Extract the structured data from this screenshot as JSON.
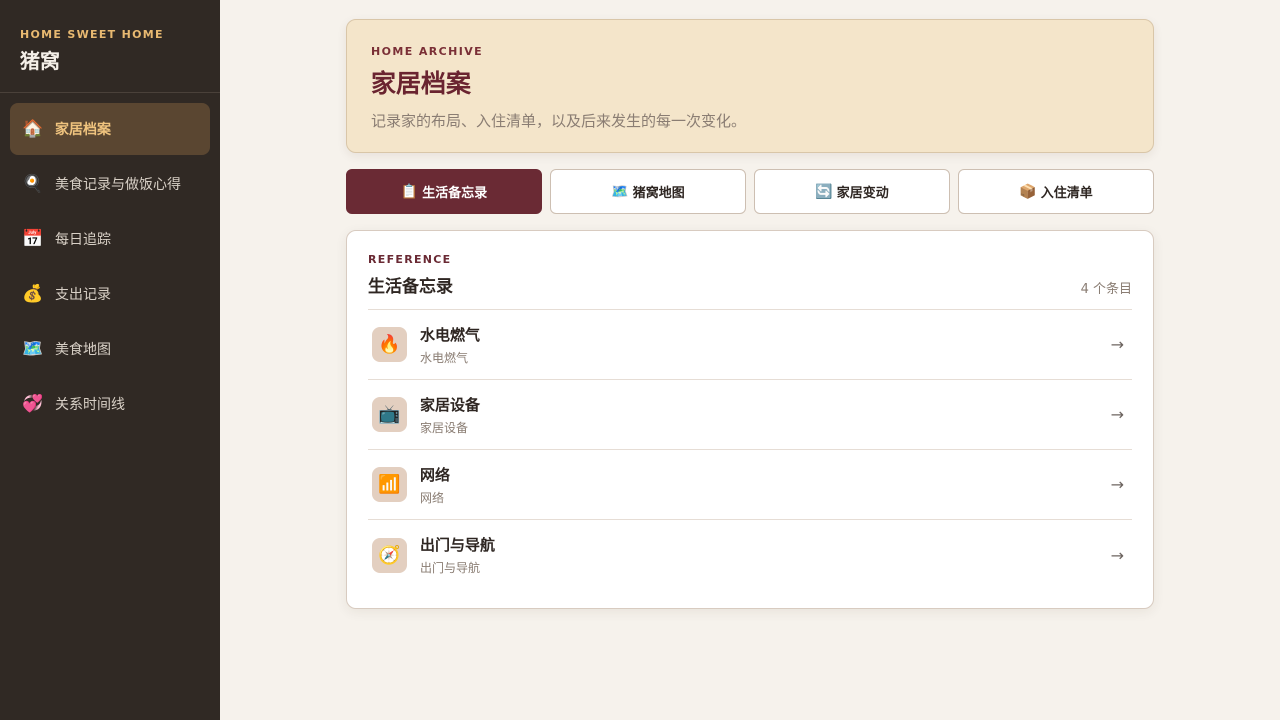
{
  "sidebar": {
    "brand_sub": "HOME SWEET HOME",
    "brand_title": "猪窝",
    "items": [
      {
        "icon": "🏠",
        "label": "家居档案",
        "active": true
      },
      {
        "icon": "🍳",
        "label": "美食记录与做饭心得"
      },
      {
        "icon": "📅",
        "label": "每日追踪"
      },
      {
        "icon": "💰",
        "label": "支出记录"
      },
      {
        "icon": "🗺️",
        "label": "美食地图"
      },
      {
        "icon": "💞",
        "label": "关系时间线"
      }
    ]
  },
  "hero": {
    "kicker": "HOME ARCHIVE",
    "title": "家居档案",
    "desc": "记录家的布局、入住清单，以及后来发生的每一次变化。"
  },
  "tabs": [
    {
      "icon": "📋",
      "label": "生活备忘录",
      "active": true
    },
    {
      "icon": "🗺️",
      "label": "猪窝地图"
    },
    {
      "icon": "🔄",
      "label": "家居变动"
    },
    {
      "icon": "📦",
      "label": "入住清单"
    }
  ],
  "card": {
    "kicker": "REFERENCE",
    "title": "生活备忘录",
    "count": "4 个条目",
    "rows": [
      {
        "icon": "🔥",
        "title": "水电燃气",
        "sub": "水电燃气"
      },
      {
        "icon": "📺",
        "title": "家居设备",
        "sub": "家居设备"
      },
      {
        "icon": "📶",
        "title": "网络",
        "sub": "网络"
      },
      {
        "icon": "🧭",
        "title": "出门与导航",
        "sub": "出门与导航"
      }
    ],
    "arrow": "→"
  },
  "colors": {
    "sidebar_bg": "#302924",
    "accent": "#6a2a34",
    "brand_gold": "#e8b971",
    "hero_bg": "#f4e5ca"
  }
}
